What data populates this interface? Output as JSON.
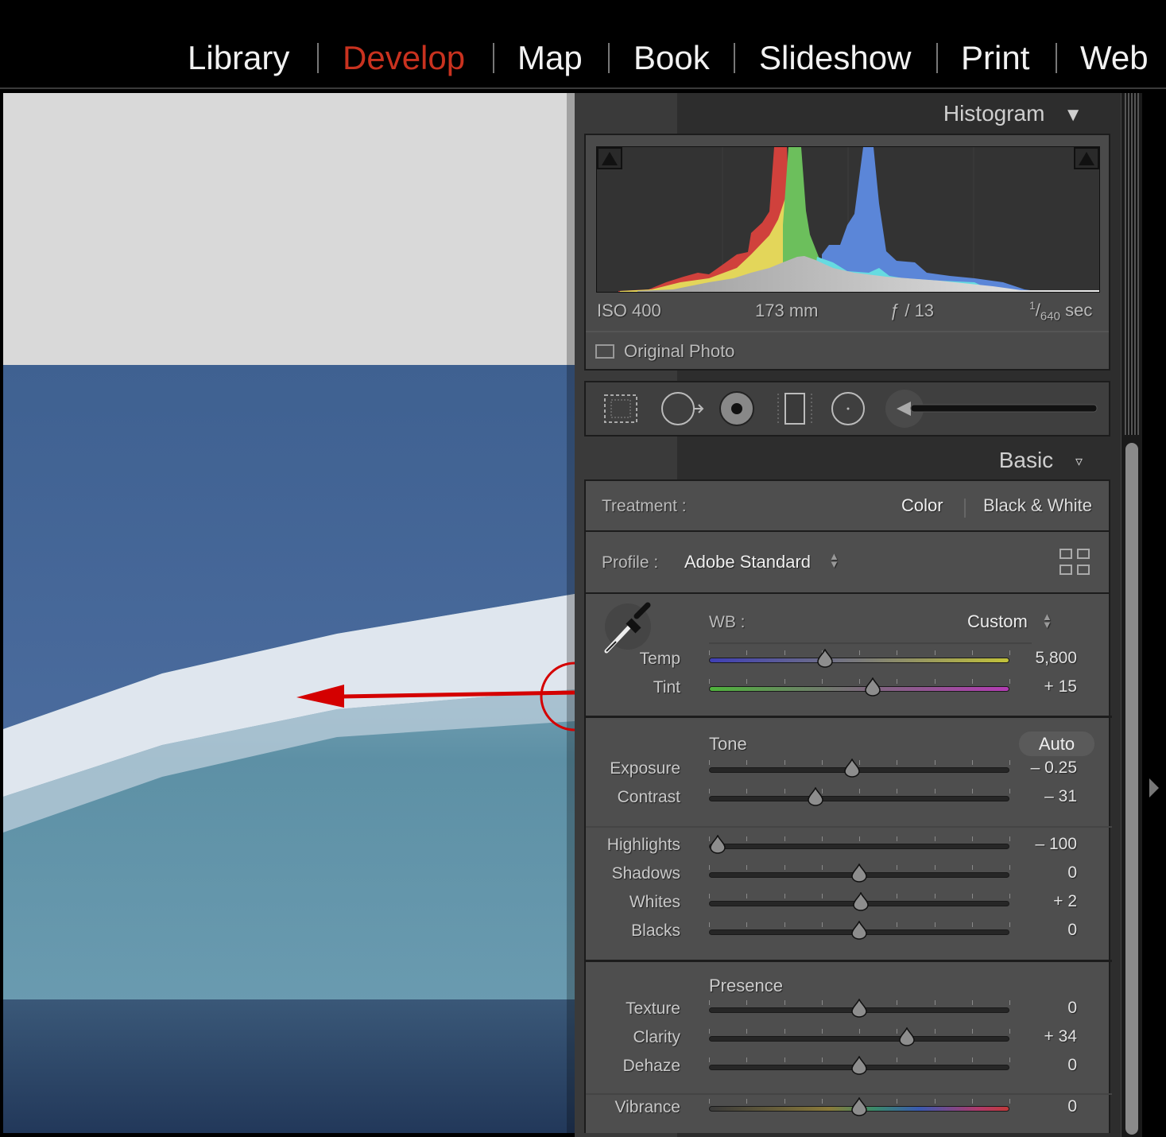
{
  "modules": [
    {
      "label": "Library",
      "active": false
    },
    {
      "label": "Develop",
      "active": true
    },
    {
      "label": "Map",
      "active": false
    },
    {
      "label": "Book",
      "active": false
    },
    {
      "label": "Slideshow",
      "active": false
    },
    {
      "label": "Print",
      "active": false
    },
    {
      "label": "Web",
      "active": false
    }
  ],
  "colors": {
    "active_module": "#c9321f",
    "annotation": "#d40000"
  },
  "histogram": {
    "title": "Histogram",
    "iso": "ISO 400",
    "focal": "173 mm",
    "aperture": "ƒ / 13",
    "shutter_num": "1",
    "shutter_den": "640",
    "shutter_unit": "sec",
    "original_photo": "Original Photo"
  },
  "basic": {
    "title": "Basic",
    "treatment_label": "Treatment :",
    "treatment_color": "Color",
    "treatment_bw": "Black & White",
    "profile_label": "Profile :",
    "profile_value": "Adobe Standard",
    "wb_label": "WB :",
    "wb_value": "Custom",
    "tone_label": "Tone",
    "auto_label": "Auto",
    "presence_label": "Presence",
    "sliders": [
      {
        "label": "Temp",
        "value": "5,800",
        "position": 0.386,
        "style": "temp"
      },
      {
        "label": "Tint",
        "value": "+ 15",
        "position": 0.545,
        "style": "tint"
      },
      {
        "label": "Exposure",
        "value": "– 0.25",
        "position": 0.476,
        "style": "plain"
      },
      {
        "label": "Contrast",
        "value": "– 31",
        "position": 0.354,
        "style": "plain"
      },
      {
        "label": "Highlights",
        "value": "– 100",
        "position": 0.03,
        "style": "plain"
      },
      {
        "label": "Shadows",
        "value": "0",
        "position": 0.5,
        "style": "plain"
      },
      {
        "label": "Whites",
        "value": "+ 2",
        "position": 0.505,
        "style": "plain"
      },
      {
        "label": "Blacks",
        "value": "0",
        "position": 0.5,
        "style": "plain"
      },
      {
        "label": "Texture",
        "value": "0",
        "position": 0.5,
        "style": "plain"
      },
      {
        "label": "Clarity",
        "value": "+ 34",
        "position": 0.66,
        "style": "plain"
      },
      {
        "label": "Dehaze",
        "value": "0",
        "position": 0.5,
        "style": "plain"
      },
      {
        "label": "Vibrance",
        "value": "0",
        "position": 0.5,
        "style": "vibrance"
      }
    ]
  }
}
